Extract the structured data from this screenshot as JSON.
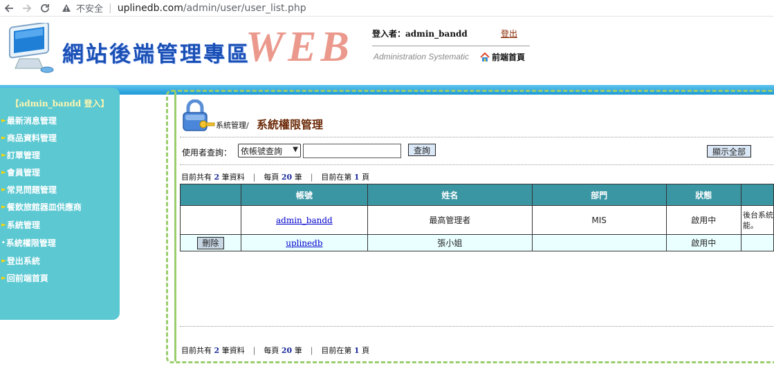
{
  "browser": {
    "insecure_label": "不安全",
    "url_domain": "uplinedb.com",
    "url_path": "/admin/user/user_list.php"
  },
  "header": {
    "site_title": "網站後端管理專區",
    "web_logo": "WEB",
    "login_label": "登入者：admin_bandd",
    "logout": "登出",
    "subtitle": "Administration Systematic",
    "home_link": "前端首頁"
  },
  "sidebar": {
    "user_label": "【admin_bandd 登入】",
    "items": [
      {
        "label": "最新消息管理"
      },
      {
        "label": "商品資料管理"
      },
      {
        "label": "訂單管理"
      },
      {
        "label": "會員管理"
      },
      {
        "label": "常見問題管理"
      },
      {
        "label": "餐飲旅館器皿供應商"
      },
      {
        "label": "系統管理"
      },
      {
        "label": "系統權限管理"
      },
      {
        "label": "登出系統"
      },
      {
        "label": "回前端首頁"
      }
    ]
  },
  "main": {
    "breadcrumb": "系統管理/",
    "title": "系統權限管理",
    "search": {
      "label": "使用者查詢：",
      "select_value": "依帳號查詢",
      "input_value": "",
      "query_button": "查詢",
      "show_all_button": "顯示全部"
    },
    "summary": {
      "prefix": "目前共有",
      "total": "2",
      "total_suffix": "筆資料",
      "per_page_prefix": "每頁",
      "per_page": "20",
      "per_page_suffix": "筆",
      "page_prefix": "目前在第",
      "page": "1",
      "page_suffix": "頁",
      "separator": "|"
    },
    "table": {
      "headers": [
        "",
        "帳號",
        "姓名",
        "部門",
        "狀態",
        ""
      ],
      "rows": [
        {
          "action": "",
          "account": "admin_bandd",
          "name": "最高管理者",
          "dept": "MIS",
          "status": "啟用中",
          "remark_line1": "後台系統",
          "remark_line2": "能。"
        },
        {
          "action": "刪除",
          "account": "uplinedb",
          "name": "張小姐",
          "dept": "",
          "status": "啟用中",
          "remark_line1": "",
          "remark_line2": ""
        }
      ]
    }
  },
  "colors": {
    "sidebar_bg": "#5bc8d2",
    "table_header_bg": "#3b96a4",
    "accent_title": "#6b2a08",
    "frame_green": "#9acd6b"
  },
  "icons": {
    "back": "arrow-left-icon",
    "forward": "arrow-right-icon",
    "reload": "reload-icon",
    "warning": "warning-triangle-icon",
    "lock": "lock-key-icon",
    "monitor": "monitor-icon",
    "home": "house-icon"
  }
}
